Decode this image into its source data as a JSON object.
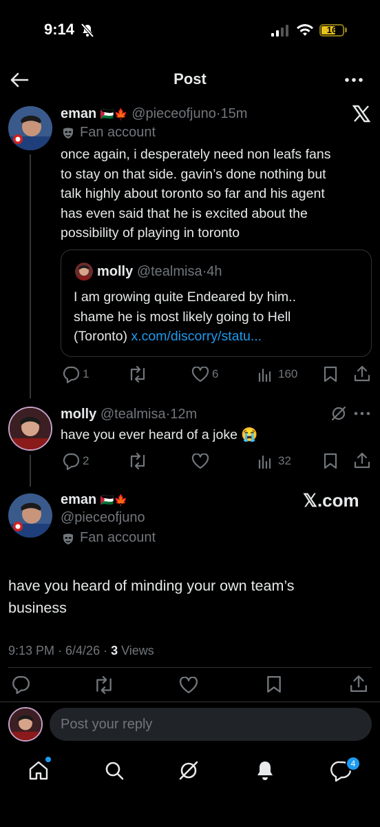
{
  "status_bar": {
    "time": "9:14",
    "battery": "16"
  },
  "header": {
    "title": "Post"
  },
  "tweet1": {
    "author_name": "eman",
    "author_flags": "🇵🇸🍁",
    "handle": "@pieceofjuno",
    "separator": "·",
    "time": "15m",
    "label": "Fan account",
    "text_lines": [
      "once again, i desperately need non leafs fans",
      "to stay on that side. gavin’s done nothing but",
      "talk highly about toronto so far and his agent",
      "has even said that he is excited about the",
      "possibility of playing in toronto"
    ],
    "quote": {
      "author_name": "molly",
      "handle": "@tealmisa",
      "separator": "·",
      "time": "4h",
      "text_line1": "I am growing quite Endeared by him..",
      "text_line2": "shame he is most likely going to Hell",
      "text_line3_prefix": "(Toronto) ",
      "text_link": "x.com/discorry/statu..."
    },
    "replies": "1",
    "retweets": "",
    "likes": "6",
    "views": "160"
  },
  "tweet2": {
    "author_name": "molly",
    "handle": "@tealmisa",
    "separator": "·",
    "time": "12m",
    "text": "have you ever heard of a joke 😭",
    "replies": "2",
    "retweets": "",
    "likes": "",
    "views": "32"
  },
  "main_post": {
    "author_name": "eman",
    "author_flags": "🇵🇸🍁",
    "handle": "@pieceofjuno",
    "label": "Fan account",
    "watermark": "𝕏.com",
    "text_line1": "have you heard of minding your own team’s",
    "text_line2": "business",
    "timestamp": "9:13 PM · 6/4/26 · ",
    "views_count": "3",
    "views_label": " Views"
  },
  "reply_box": {
    "placeholder": "Post your reply"
  },
  "bottom_nav": {
    "messages_badge": "4"
  },
  "colors": {
    "background": "#000000",
    "text": "#e7e9ea",
    "dim": "#71767b",
    "accent": "#1d9bf0"
  }
}
